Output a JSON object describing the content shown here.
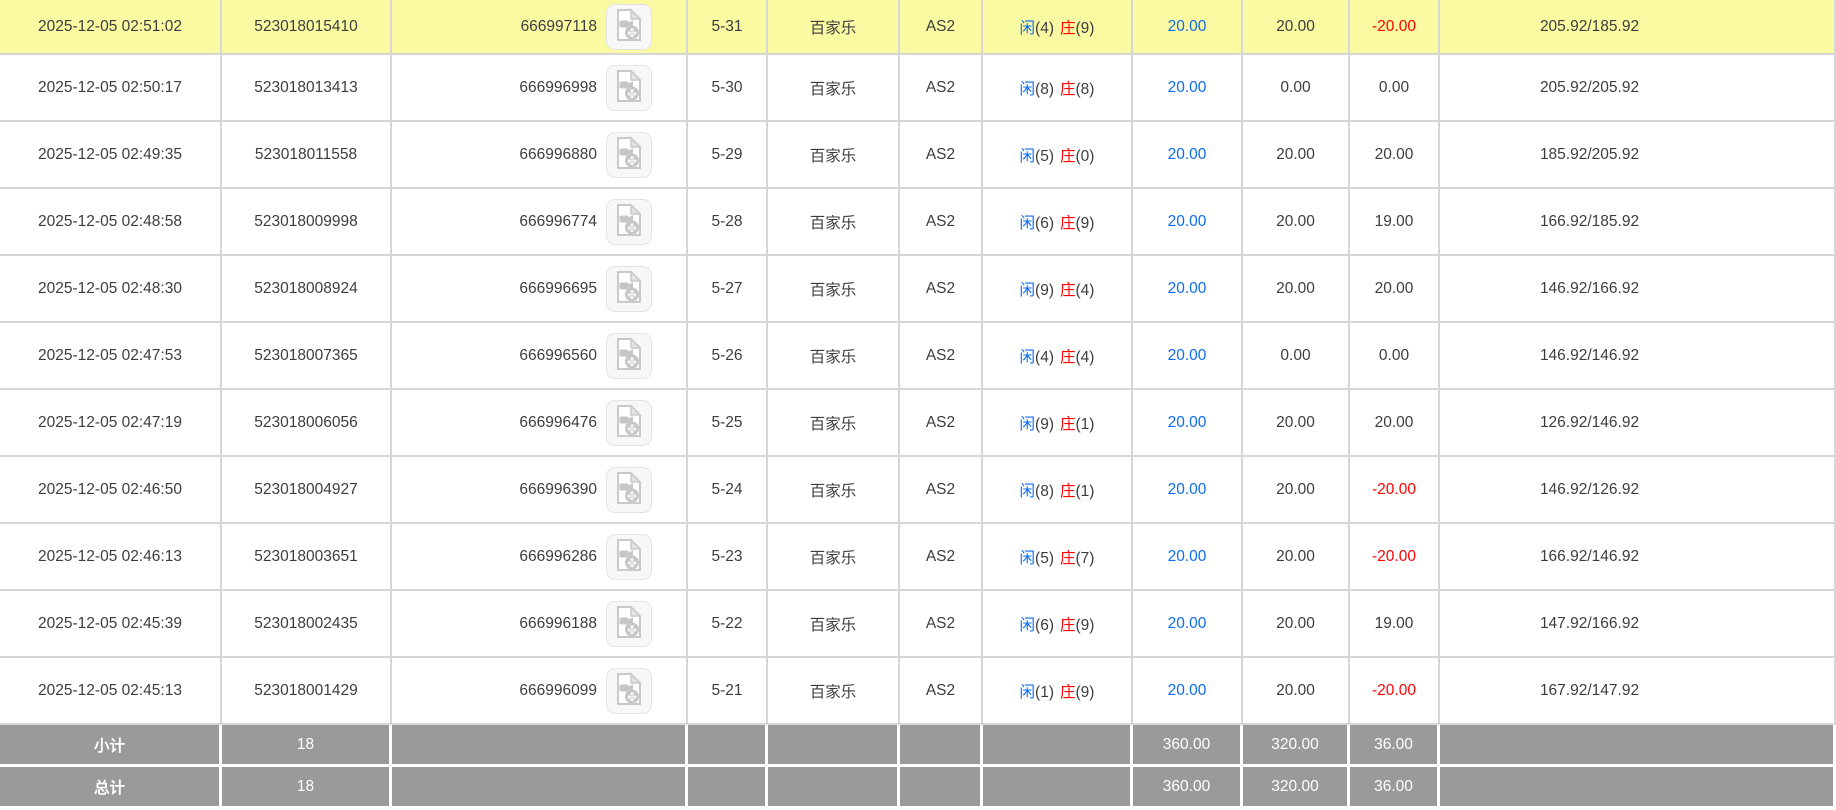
{
  "table": {
    "rows": [
      {
        "time": "2025-12-05 02:51:02",
        "bet_id": "523018015410",
        "round_id": "666997118",
        "table_no": "5-31",
        "game": "百家乐",
        "platform": "AS2",
        "player_label": "闲",
        "player_score": "4",
        "banker_label": "庄",
        "banker_score": "9",
        "bet": "20.00",
        "valid_bet": "20.00",
        "win_loss": "-20.00",
        "balance": "205.92/185.92",
        "highlighted": true
      },
      {
        "time": "2025-12-05 02:50:17",
        "bet_id": "523018013413",
        "round_id": "666996998",
        "table_no": "5-30",
        "game": "百家乐",
        "platform": "AS2",
        "player_label": "闲",
        "player_score": "8",
        "banker_label": "庄",
        "banker_score": "8",
        "bet": "20.00",
        "valid_bet": "0.00",
        "win_loss": "0.00",
        "balance": "205.92/205.92",
        "highlighted": false
      },
      {
        "time": "2025-12-05 02:49:35",
        "bet_id": "523018011558",
        "round_id": "666996880",
        "table_no": "5-29",
        "game": "百家乐",
        "platform": "AS2",
        "player_label": "闲",
        "player_score": "5",
        "banker_label": "庄",
        "banker_score": "0",
        "bet": "20.00",
        "valid_bet": "20.00",
        "win_loss": "20.00",
        "balance": "185.92/205.92",
        "highlighted": false
      },
      {
        "time": "2025-12-05 02:48:58",
        "bet_id": "523018009998",
        "round_id": "666996774",
        "table_no": "5-28",
        "game": "百家乐",
        "platform": "AS2",
        "player_label": "闲",
        "player_score": "6",
        "banker_label": "庄",
        "banker_score": "9",
        "bet": "20.00",
        "valid_bet": "20.00",
        "win_loss": "19.00",
        "balance": "166.92/185.92",
        "highlighted": false
      },
      {
        "time": "2025-12-05 02:48:30",
        "bet_id": "523018008924",
        "round_id": "666996695",
        "table_no": "5-27",
        "game": "百家乐",
        "platform": "AS2",
        "player_label": "闲",
        "player_score": "9",
        "banker_label": "庄",
        "banker_score": "4",
        "bet": "20.00",
        "valid_bet": "20.00",
        "win_loss": "20.00",
        "balance": "146.92/166.92",
        "highlighted": false
      },
      {
        "time": "2025-12-05 02:47:53",
        "bet_id": "523018007365",
        "round_id": "666996560",
        "table_no": "5-26",
        "game": "百家乐",
        "platform": "AS2",
        "player_label": "闲",
        "player_score": "4",
        "banker_label": "庄",
        "banker_score": "4",
        "bet": "20.00",
        "valid_bet": "0.00",
        "win_loss": "0.00",
        "balance": "146.92/146.92",
        "highlighted": false
      },
      {
        "time": "2025-12-05 02:47:19",
        "bet_id": "523018006056",
        "round_id": "666996476",
        "table_no": "5-25",
        "game": "百家乐",
        "platform": "AS2",
        "player_label": "闲",
        "player_score": "9",
        "banker_label": "庄",
        "banker_score": "1",
        "bet": "20.00",
        "valid_bet": "20.00",
        "win_loss": "20.00",
        "balance": "126.92/146.92",
        "highlighted": false
      },
      {
        "time": "2025-12-05 02:46:50",
        "bet_id": "523018004927",
        "round_id": "666996390",
        "table_no": "5-24",
        "game": "百家乐",
        "platform": "AS2",
        "player_label": "闲",
        "player_score": "8",
        "banker_label": "庄",
        "banker_score": "1",
        "bet": "20.00",
        "valid_bet": "20.00",
        "win_loss": "-20.00",
        "balance": "146.92/126.92",
        "highlighted": false
      },
      {
        "time": "2025-12-05 02:46:13",
        "bet_id": "523018003651",
        "round_id": "666996286",
        "table_no": "5-23",
        "game": "百家乐",
        "platform": "AS2",
        "player_label": "闲",
        "player_score": "5",
        "banker_label": "庄",
        "banker_score": "7",
        "bet": "20.00",
        "valid_bet": "20.00",
        "win_loss": "-20.00",
        "balance": "166.92/146.92",
        "highlighted": false
      },
      {
        "time": "2025-12-05 02:45:39",
        "bet_id": "523018002435",
        "round_id": "666996188",
        "table_no": "5-22",
        "game": "百家乐",
        "platform": "AS2",
        "player_label": "闲",
        "player_score": "6",
        "banker_label": "庄",
        "banker_score": "9",
        "bet": "20.00",
        "valid_bet": "20.00",
        "win_loss": "19.00",
        "balance": "147.92/166.92",
        "highlighted": false
      },
      {
        "time": "2025-12-05 02:45:13",
        "bet_id": "523018001429",
        "round_id": "666996099",
        "table_no": "5-21",
        "game": "百家乐",
        "platform": "AS2",
        "player_label": "闲",
        "player_score": "1",
        "banker_label": "庄",
        "banker_score": "9",
        "bet": "20.00",
        "valid_bet": "20.00",
        "win_loss": "-20.00",
        "balance": "167.92/147.92",
        "highlighted": false
      }
    ],
    "subtotal": {
      "label": "小计",
      "count": "18",
      "bet": "360.00",
      "valid_bet": "320.00",
      "win_loss": "36.00"
    },
    "total": {
      "label": "总计",
      "count": "18",
      "bet": "360.00",
      "valid_bet": "320.00",
      "win_loss": "36.00"
    },
    "icons": {
      "video_button": "video-replay-icon"
    }
  },
  "colors": {
    "highlight": "#fafaa3",
    "grid": "#d6d6d6",
    "blue": "#0c6cf2",
    "red": "#ff0000",
    "summary_bg": "#9a9a9a",
    "text": "#3d3d3d"
  }
}
